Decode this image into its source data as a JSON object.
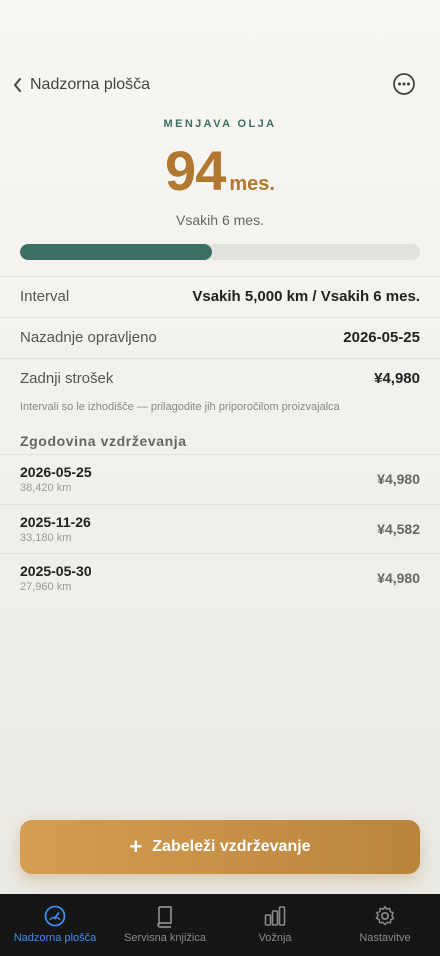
{
  "nav": {
    "back_label": "Nadzorna plošča"
  },
  "header": {
    "title": "MENJAVA OLJA",
    "value": "94",
    "unit": "mes.",
    "subtitle": "Vsakih 6 mes."
  },
  "progress": {
    "fraction": 0.48,
    "fill_color": "#3d6e63"
  },
  "details": [
    {
      "key": "Interval",
      "value": "Vsakih 5,000 km / Vsakih 6 mes."
    },
    {
      "key": "Nazadnje opravljeno",
      "value": "2026-05-25"
    },
    {
      "key": "Zadnji strošek",
      "value": "¥4,980"
    }
  ],
  "note": "Intervali so le izhodišče — prilagodite jih priporočilom proizvajalca",
  "history": {
    "title": "Zgodovina vzdrževanja",
    "items": [
      {
        "date": "2026-05-25",
        "km": "38,420 km",
        "amount": "¥4,980"
      },
      {
        "date": "2025-11-26",
        "km": "33,180 km",
        "amount": "¥4,582"
      },
      {
        "date": "2025-05-30",
        "km": "27,960 km",
        "amount": "¥4,980"
      }
    ]
  },
  "cta": {
    "label": "Zabeleži vzdrževanje"
  },
  "tabs": [
    {
      "label": "Nadzorna plošča",
      "icon": "gauge-icon",
      "active": true
    },
    {
      "label": "Servisna knjižica",
      "icon": "book-icon",
      "active": false
    },
    {
      "label": "Vožnja",
      "icon": "bar-chart-icon",
      "active": false
    },
    {
      "label": "Nastavitve",
      "icon": "gear-icon",
      "active": false
    }
  ],
  "colors": {
    "accent": "#b27832",
    "teal": "#3d6e60",
    "tab_active": "#3f8cf0"
  }
}
